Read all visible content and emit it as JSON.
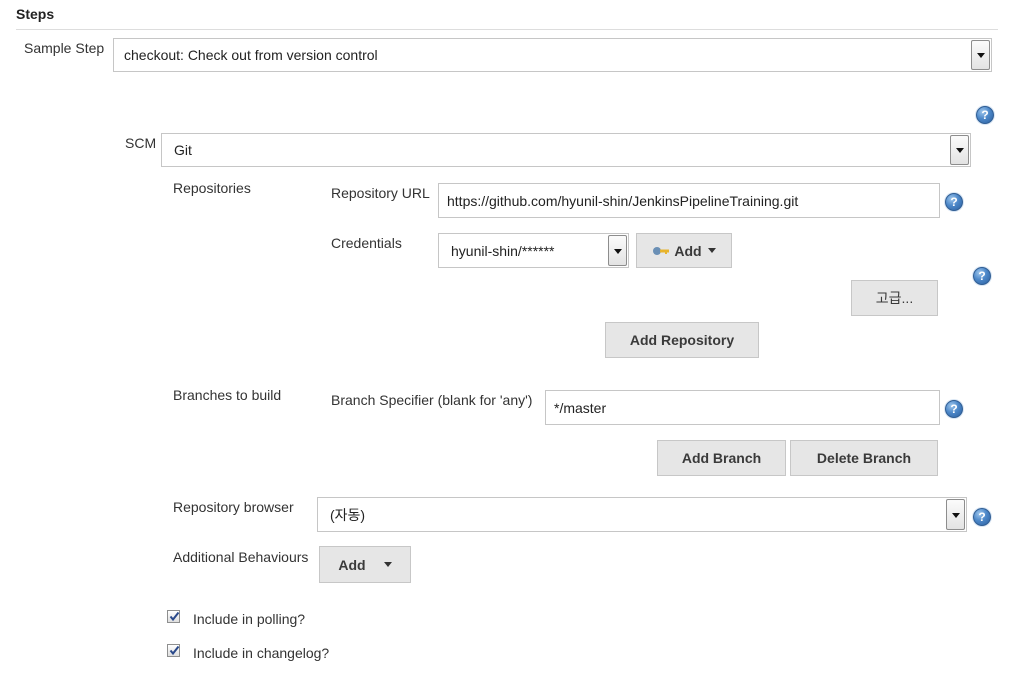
{
  "section": {
    "title": "Steps"
  },
  "sample_step": {
    "label": "Sample Step",
    "value": "checkout: Check out from version control"
  },
  "scm": {
    "label": "SCM",
    "value": "Git",
    "repositories": {
      "label": "Repositories",
      "url_label": "Repository URL",
      "url_value": "https://github.com/hyunil-shin/JenkinsPipelineTraining.git",
      "credentials_label": "Credentials",
      "credentials_value": "hyunil-shin/******",
      "add_label": "Add",
      "advanced_label": "고급...",
      "add_repository_label": "Add Repository"
    },
    "branches": {
      "label": "Branches to build",
      "specifier_label": "Branch Specifier (blank for 'any')",
      "specifier_value": "*/master",
      "add_branch_label": "Add Branch",
      "delete_branch_label": "Delete Branch"
    },
    "repo_browser": {
      "label": "Repository browser",
      "value": "(자동)"
    },
    "additional_behaviours": {
      "label": "Additional Behaviours",
      "add_label": "Add"
    },
    "include_polling": {
      "label": "Include in polling?",
      "checked": true
    },
    "include_changelog": {
      "label": "Include in changelog?",
      "checked": true
    }
  },
  "help_icon": "?",
  "colors": {
    "help_blue": "#4d88c9",
    "button_bg": "#e6e6e6",
    "border": "#c6c6c6"
  }
}
